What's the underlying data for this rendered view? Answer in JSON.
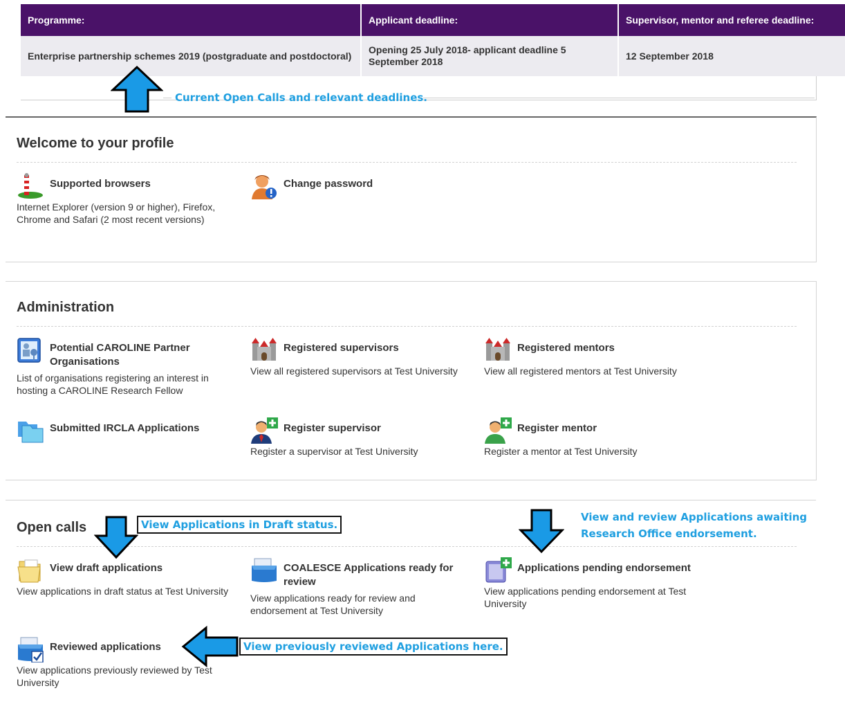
{
  "calls_table": {
    "headers": [
      "Programme:",
      "Applicant deadline:",
      "Supervisor, mentor and referee deadline:"
    ],
    "row": [
      "Enterprise partnership schemes 2019 (postgraduate and postdoctoral)",
      "Opening 25 July 2018- applicant deadline 5 September 2018",
      "12 September 2018"
    ]
  },
  "annotations": {
    "open_calls_note": "Current Open Calls and relevant deadlines.",
    "draft_note": "View Applications in Draft status.",
    "pending_note_line1": "View and review Applications awaiting",
    "pending_note_line2": "Research Office endorsement.",
    "reviewed_note": "View previously reviewed Applications here."
  },
  "profile": {
    "title": "Welcome to your profile",
    "items": [
      {
        "label": "Supported browsers",
        "desc": "Internet Explorer (version 9 or higher), Firefox, Chrome and Safari (2 most recent versions)",
        "icon": "browser-pole-icon"
      },
      {
        "label": "Change password",
        "desc": "",
        "icon": "user-alert-icon"
      }
    ]
  },
  "administration": {
    "title": "Administration",
    "items": [
      {
        "label": "Potential CAROLINE Partner Organisations",
        "desc": "List of organisations registering an interest in hosting a CAROLINE Research Fellow",
        "icon": "organisation-directory-icon"
      },
      {
        "label": "Registered supervisors",
        "desc": "View all registered supervisors at Test University",
        "icon": "castle-icon"
      },
      {
        "label": "Registered mentors",
        "desc": "View all registered mentors at Test University",
        "icon": "castle-icon"
      },
      {
        "label": "Submitted IRCLA Applications",
        "desc": "",
        "icon": "folders-icon"
      },
      {
        "label": "Register supervisor",
        "desc": "Register a supervisor at Test University",
        "icon": "add-supervisor-icon"
      },
      {
        "label": "Register mentor",
        "desc": "Register a mentor at Test University",
        "icon": "add-mentor-icon"
      }
    ]
  },
  "open_calls": {
    "title": "Open calls",
    "items": [
      {
        "label": "View draft applications",
        "desc": "View applications in draft status at Test University",
        "icon": "draft-folder-icon"
      },
      {
        "label": "COALESCE Applications ready for review",
        "desc": "View applications ready for review and endorsement at Test University",
        "icon": "file-box-icon"
      },
      {
        "label": "Applications pending endorsement",
        "desc": "View applications pending endorsement at Test University",
        "icon": "add-document-icon"
      },
      {
        "label": "Reviewed applications",
        "desc": "View applications previously reviewed by Test University",
        "icon": "checked-box-icon"
      }
    ]
  },
  "colors": {
    "header_bg": "#4a1268",
    "row_bg": "#ecebf0",
    "annotation_blue": "#1f9fe0",
    "arrow_fill": "#1a9ae6"
  }
}
